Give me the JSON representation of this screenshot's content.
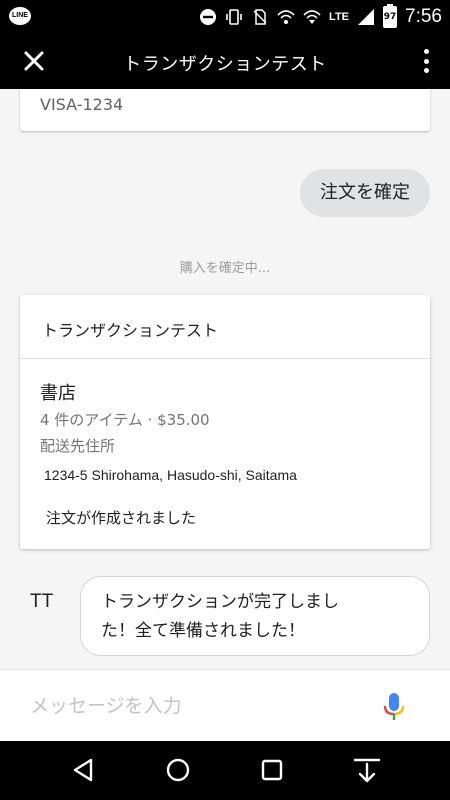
{
  "status_bar": {
    "app_badge": "LINE",
    "network": "LTE",
    "battery": "97",
    "time": "7:56"
  },
  "app_bar": {
    "title": "トランザクションテスト",
    "icons": [
      "close-icon",
      "more-vert-icon"
    ]
  },
  "chat": {
    "payment_card": {
      "payment_method": "VISA-1234"
    },
    "user_message": "注文を確定",
    "status_message": "購入を確定中...",
    "receipt": {
      "header": "トランザクションテスト",
      "store": "書店",
      "items_summary": "4 件のアイテム · $35.00",
      "shipping_label": "配送先住所",
      "address": "1234-5 Shirohama, Hasudo-shi, Saitama",
      "order_status": "注文が作成されました"
    },
    "agent": {
      "avatar_initials": "TT",
      "message_line1": "トランザクションが完了しまし",
      "message_line2": "た！全て準備されました！"
    }
  },
  "input": {
    "placeholder": "メッセージを入力",
    "value": ""
  },
  "nav_bar": {
    "icons": [
      "back-icon",
      "home-icon",
      "recents-icon",
      "keyboard-hide-icon"
    ]
  },
  "colors": {
    "app_bar": "#000000",
    "chat_background": "#f5f5f5",
    "user_bubble": "#e1e2e3",
    "mic_blue": "#4285f4",
    "mic_red": "#ea4335",
    "mic_yellow": "#fbbc05",
    "mic_green": "#34a853"
  }
}
